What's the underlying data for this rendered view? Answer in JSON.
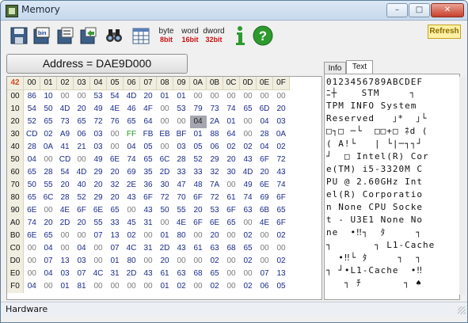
{
  "window": {
    "title": "Memory"
  },
  "toolbar": {
    "byte_label": "byte",
    "byte_bits": "8bit",
    "word_label": "word",
    "word_bits": "16bit",
    "dword_label": "dword",
    "dword_bits": "32bit",
    "refresh_label": "Refresh"
  },
  "address_label": "Address = DAE9D000",
  "hex": {
    "corner": "42",
    "columns": [
      "00",
      "01",
      "02",
      "03",
      "04",
      "05",
      "06",
      "07",
      "08",
      "09",
      "0A",
      "0B",
      "0C",
      "0D",
      "0E",
      "0F"
    ],
    "rows": [
      {
        "addr": "00",
        "cells": [
          "86",
          "10",
          "00",
          "00",
          "53",
          "54",
          "4D",
          "20",
          "01",
          "01",
          "00",
          "00",
          "00",
          "00",
          "00",
          "00"
        ]
      },
      {
        "addr": "10",
        "cells": [
          "54",
          "50",
          "4D",
          "20",
          "49",
          "4E",
          "46",
          "4F",
          "00",
          "53",
          "79",
          "73",
          "74",
          "65",
          "6D",
          "20"
        ]
      },
      {
        "addr": "20",
        "cells": [
          "52",
          "65",
          "73",
          "65",
          "72",
          "76",
          "65",
          "64",
          "00",
          "00",
          "04",
          "2A",
          "01",
          "00",
          "04",
          "03"
        ]
      },
      {
        "addr": "30",
        "cells": [
          "CD",
          "02",
          "A9",
          "06",
          "03",
          "00",
          "FF",
          "FB",
          "EB",
          "BF",
          "01",
          "88",
          "64",
          "00",
          "28",
          "0A"
        ]
      },
      {
        "addr": "40",
        "cells": [
          "28",
          "0A",
          "41",
          "21",
          "03",
          "00",
          "04",
          "05",
          "00",
          "03",
          "05",
          "06",
          "02",
          "02",
          "04",
          "02"
        ]
      },
      {
        "addr": "50",
        "cells": [
          "04",
          "00",
          "CD",
          "00",
          "49",
          "6E",
          "74",
          "65",
          "6C",
          "28",
          "52",
          "29",
          "20",
          "43",
          "6F",
          "72"
        ]
      },
      {
        "addr": "60",
        "cells": [
          "65",
          "28",
          "54",
          "4D",
          "29",
          "20",
          "69",
          "35",
          "2D",
          "33",
          "33",
          "32",
          "30",
          "4D",
          "20",
          "43"
        ]
      },
      {
        "addr": "70",
        "cells": [
          "50",
          "55",
          "20",
          "40",
          "20",
          "32",
          "2E",
          "36",
          "30",
          "47",
          "48",
          "7A",
          "00",
          "49",
          "6E",
          "74"
        ]
      },
      {
        "addr": "80",
        "cells": [
          "65",
          "6C",
          "28",
          "52",
          "29",
          "20",
          "43",
          "6F",
          "72",
          "70",
          "6F",
          "72",
          "61",
          "74",
          "69",
          "6F"
        ]
      },
      {
        "addr": "90",
        "cells": [
          "6E",
          "00",
          "4E",
          "6F",
          "6E",
          "65",
          "00",
          "43",
          "50",
          "55",
          "20",
          "53",
          "6F",
          "63",
          "6B",
          "65"
        ]
      },
      {
        "addr": "A0",
        "cells": [
          "74",
          "20",
          "2D",
          "20",
          "55",
          "33",
          "45",
          "31",
          "00",
          "4E",
          "6F",
          "6E",
          "65",
          "00",
          "4E",
          "6F"
        ]
      },
      {
        "addr": "B0",
        "cells": [
          "6E",
          "65",
          "00",
          "00",
          "07",
          "13",
          "02",
          "00",
          "01",
          "80",
          "00",
          "20",
          "00",
          "02",
          "00",
          "02"
        ]
      },
      {
        "addr": "C0",
        "cells": [
          "00",
          "04",
          "00",
          "04",
          "00",
          "07",
          "4C",
          "31",
          "2D",
          "43",
          "61",
          "63",
          "68",
          "65",
          "00",
          "00"
        ]
      },
      {
        "addr": "D0",
        "cells": [
          "00",
          "07",
          "13",
          "03",
          "00",
          "01",
          "80",
          "00",
          "20",
          "00",
          "00",
          "02",
          "00",
          "02",
          "00",
          "02"
        ]
      },
      {
        "addr": "E0",
        "cells": [
          "00",
          "04",
          "03",
          "07",
          "4C",
          "31",
          "2D",
          "43",
          "61",
          "63",
          "68",
          "65",
          "00",
          "00",
          "07",
          "13"
        ]
      },
      {
        "addr": "F0",
        "cells": [
          "04",
          "00",
          "01",
          "81",
          "00",
          "00",
          "00",
          "00",
          "01",
          "02",
          "00",
          "02",
          "00",
          "02",
          "06",
          "05"
        ]
      }
    ]
  },
  "tabs": [
    {
      "label": "Info"
    },
    {
      "label": "Text"
    }
  ],
  "text_panel": {
    "header": "0123456789ABCDEF",
    "lines": [
      "ﾆ┼    STM     ┐",
      "TPM INFO System ",
      "Reserved   ｣*  ｣└",
      "□┐□ ─└  □□+□ ﾈd (",
      "( A!└   | └|─┐┐┘",
      "┘  □ Intel(R) Cor",
      "e(TM) i5-3320M C",
      "PU @ 2.60GHz Int",
      "el(R) Corporatio",
      "n None CPU Socke",
      "t - U3E1 None No",
      "ne  •‼┐  ﾀ     ┐",
      "┐       ┐ L1-Cache",
      "  •‼└ ﾀ     ┐  ┐",
      "┐ ┘•L1-Cache  •‼",
      "   ┐ ﾁ       ┐ ♠"
    ]
  },
  "status": {
    "text": "Hardware"
  }
}
